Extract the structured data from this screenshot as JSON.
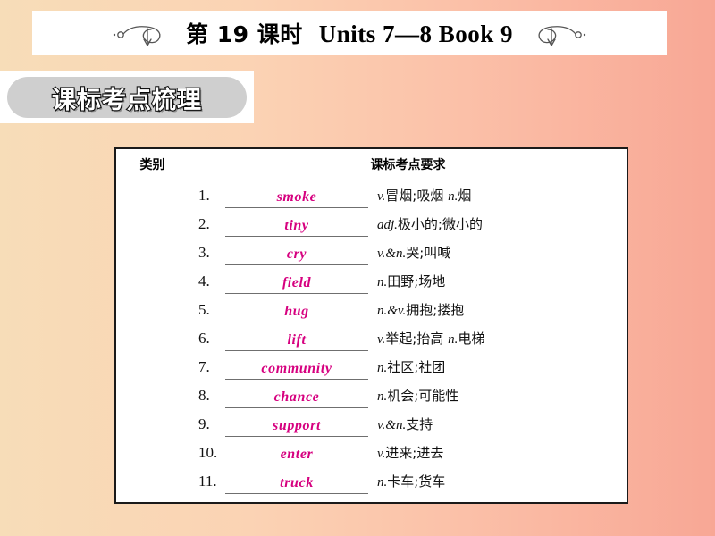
{
  "title_banner": {
    "lesson_label": "第 19 课时",
    "units_label": "Units 7—8 Book 9",
    "left_ornament": "flourish-swirl-icon",
    "right_ornament": "flourish-swirl-icon"
  },
  "section_badge": {
    "label": "课标考点梳理"
  },
  "table": {
    "headers": {
      "category": "类别",
      "requirement": "课标考点要求"
    },
    "category_value": "",
    "rows": [
      {
        "num": "1.",
        "answer": "smoke",
        "pos": "v.",
        "meaning": "冒烟;吸烟 ",
        "pos2": "n.",
        "meaning2": "烟"
      },
      {
        "num": "2.",
        "answer": "tiny",
        "pos": "adj.",
        "meaning": "极小的;微小的",
        "pos2": "",
        "meaning2": ""
      },
      {
        "num": "3.",
        "answer": "cry",
        "pos": "v.&n.",
        "meaning": "哭;叫喊",
        "pos2": "",
        "meaning2": ""
      },
      {
        "num": "4.",
        "answer": "field",
        "pos": "n.",
        "meaning": "田野;场地",
        "pos2": "",
        "meaning2": ""
      },
      {
        "num": "5.",
        "answer": "hug",
        "pos": "n.&v.",
        "meaning": "拥抱;搂抱",
        "pos2": "",
        "meaning2": ""
      },
      {
        "num": "6.",
        "answer": "lift",
        "pos": "v.",
        "meaning": "举起;抬高 ",
        "pos2": "n.",
        "meaning2": "电梯"
      },
      {
        "num": "7.",
        "answer": "community",
        "pos": "n.",
        "meaning": "社区;社团",
        "pos2": "",
        "meaning2": ""
      },
      {
        "num": "8.",
        "answer": "chance",
        "pos": "n.",
        "meaning": "机会;可能性",
        "pos2": "",
        "meaning2": ""
      },
      {
        "num": "9.",
        "answer": "support",
        "pos": "v.&n.",
        "meaning": "支持",
        "pos2": "",
        "meaning2": ""
      },
      {
        "num": "10.",
        "answer": "enter",
        "pos": "v.",
        "meaning": "进来;进去",
        "pos2": "",
        "meaning2": ""
      },
      {
        "num": "11.",
        "answer": "truck",
        "pos": "n.",
        "meaning": "卡车;货车",
        "pos2": "",
        "meaning2": ""
      }
    ]
  },
  "colors": {
    "answer_pink": "#d6007f",
    "background_left": "#f7ddb8",
    "background_right": "#f8a795",
    "badge_fill": "#cfcfcf",
    "table_border": "#1a1a1a"
  }
}
